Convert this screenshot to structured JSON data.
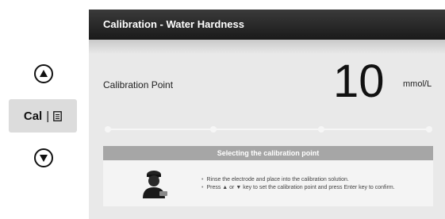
{
  "controls": {
    "cal_label": "Cal",
    "up_icon": "arrow-up-icon",
    "down_icon": "arrow-down-icon",
    "doc_icon": "document-icon"
  },
  "screen": {
    "title": "Calibration - Water Hardness",
    "cal_point_label": "Calibration Point",
    "value": "10",
    "unit": "mmol/L",
    "track": {
      "points": 4,
      "selected": 1
    },
    "panel": {
      "heading": "Selecting the calibration point",
      "instructions": [
        "Rinse the electrode and place into the calibration solution.",
        "Press ▲ or ▼ key to set the calibration point and press Enter key to confirm."
      ],
      "icon": "technician-icon"
    }
  },
  "colors": {
    "title_bar": "#1a1a1a",
    "screen_bg": "#e9e9e9",
    "panel_head": "#a6a6a6"
  }
}
